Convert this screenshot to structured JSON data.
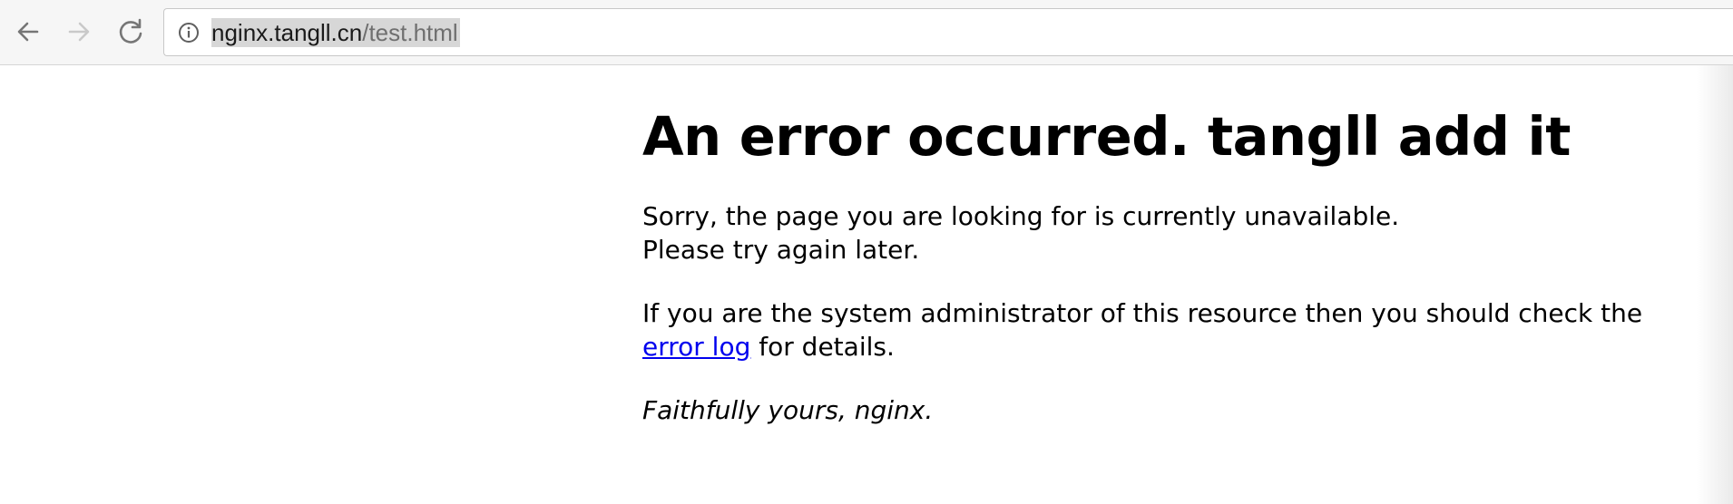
{
  "browser": {
    "url_host": "nginx.tangll.cn",
    "url_path": "/test.html",
    "icons": {
      "back": "arrow-left-icon",
      "forward": "arrow-right-icon",
      "reload": "reload-icon",
      "site_info": "info-icon"
    }
  },
  "page": {
    "heading": "An error occurred. tangll add it",
    "para1_line1": "Sorry, the page you are looking for is currently unavailable.",
    "para1_line2": "Please try again later.",
    "para2_line1": "If you are the system administrator of this resource then you should check the",
    "error_log_link": "error log",
    "para2_after_link": " for details.",
    "signature": "Faithfully yours, nginx."
  },
  "colors": {
    "link": "#0000ee",
    "toolbar_bg": "#f6f6f6",
    "url_selection": "#d7d7d7"
  }
}
